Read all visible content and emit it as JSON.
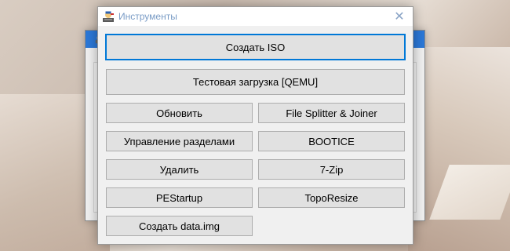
{
  "window": {
    "title": "Инструменты",
    "close_glyph": "✕",
    "icon": "tools-app-icon"
  },
  "buttons": {
    "create_iso": "Создать ISO",
    "test_boot": "Тестовая загрузка [QEMU]",
    "refresh": "Обновить",
    "file_splitter": "File Splitter & Joiner",
    "partition_mgmt": "Управление разделами",
    "bootice": "BOOTICE",
    "delete": "Удалить",
    "seven_zip": "7-Zip",
    "pestartup": "PEStartup",
    "toporesize": "TopoResize",
    "create_data_img": "Создать data.img"
  },
  "colors": {
    "focus_border": "#0078d7",
    "button_bg": "#e1e1e1",
    "window_bg": "#f0f0f0"
  }
}
